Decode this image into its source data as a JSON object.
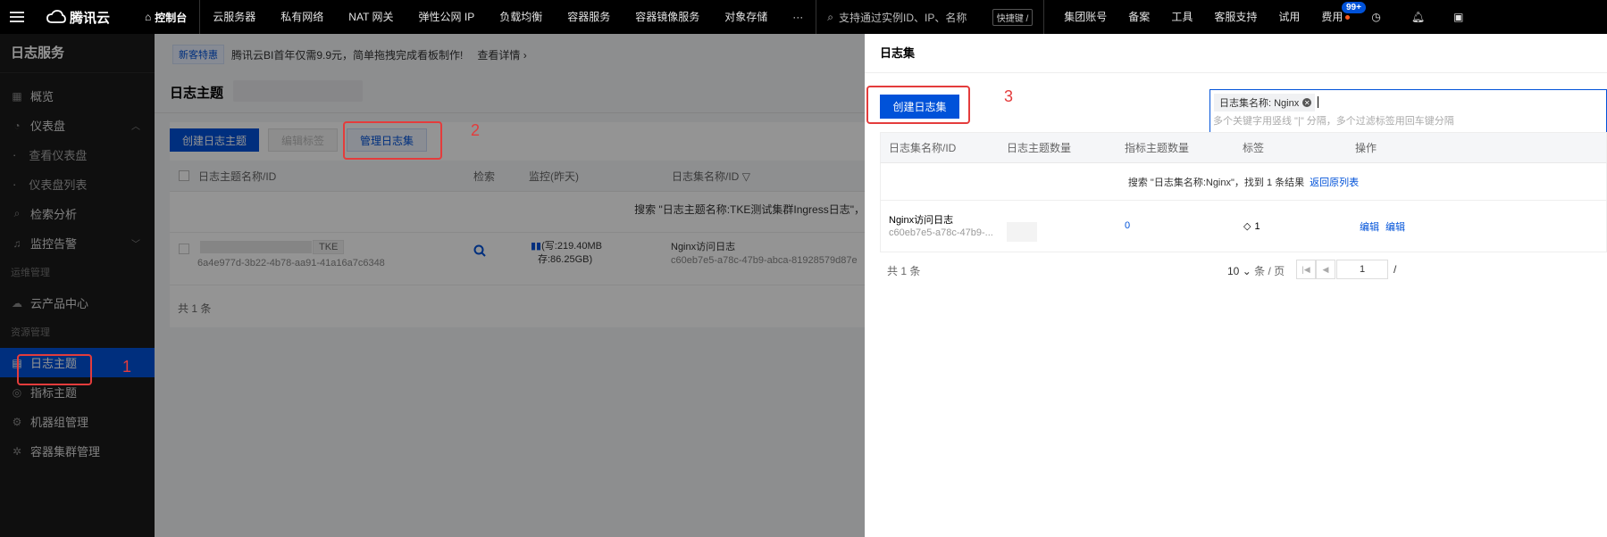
{
  "topnav": {
    "brand": "腾讯云",
    "console": "控制台",
    "items": [
      "云服务器",
      "私有网络",
      "NAT 网关",
      "弹性公网 IP",
      "负载均衡",
      "容器服务",
      "容器镜像服务",
      "对象存储",
      "···"
    ],
    "search_placeholder": "支持通过实例ID、IP、名称",
    "shortcut": "快捷键 /",
    "right_items": [
      "集团账号",
      "备案",
      "工具",
      "客服支持",
      "试用",
      "费用"
    ],
    "badge": "99+"
  },
  "sidebar": {
    "title": "日志服务",
    "items": {
      "overview": "概览",
      "dashboard": "仪表盘",
      "dashboard_view": "查看仪表盘",
      "dashboard_list": "仪表盘列表",
      "search": "检索分析",
      "alarm": "监控告警",
      "ops_group": "运维管理",
      "cloud_center": "云产品中心",
      "resource_group": "资源管理",
      "log_topic": "日志主题",
      "metric_topic": "指标主题",
      "machine_group": "机器组管理",
      "container_cluster": "容器集群管理"
    }
  },
  "main": {
    "promo_tag": "新客特惠",
    "promo_text": "腾讯云BI首年仅需9.9元，简单拖拽完成看板制作!",
    "promo_link": "查看详情",
    "page_title": "日志主题",
    "toolbar": {
      "create": "创建日志主题",
      "edit_tags": "编辑标签",
      "manage": "管理日志集"
    },
    "columns": [
      "日志主题名称/ID",
      "检索",
      "监控(昨天)",
      "日志集名称/ID"
    ],
    "search_hint": "搜索 \"日志主题名称:TKE测试集群Ingress日志\"，",
    "row": {
      "tag": "TKE",
      "id": "6a4e977d-3b22-4b78-aa91-41a16a7c6348",
      "monitor_write": "(写:219.40MB",
      "monitor_store": "存:86.25GB)",
      "logset_name": "Nginx访问日志",
      "logset_id": "c60eb7e5-a78c-47b9-abca-81928579d87e"
    },
    "total": "共 1 条"
  },
  "drawer": {
    "title": "日志集",
    "create": "创建日志集",
    "filter_chip": "日志集名称: Nginx",
    "filter_hint": "多个关键字用竖线 \"|\" 分隔，多个过滤标签用回车键分隔",
    "columns": [
      "日志集名称/ID",
      "日志主题数量",
      "指标主题数量",
      "标签",
      "操作"
    ],
    "result_text": "搜索 \"日志集名称:Nginx\"，找到 1 条结果",
    "result_link": "返回原列表",
    "row": {
      "name": "Nginx访问日志",
      "id": "c60eb7e5-a78c-47b9-...",
      "metric_count": "0",
      "tag_count": "1",
      "edit": "编辑",
      "edit2": "编辑"
    },
    "pager": {
      "total": "共 1 条",
      "size": "10",
      "size_unit": "条 / 页",
      "page": "1",
      "slash": "/"
    }
  },
  "annotations": [
    "1",
    "2",
    "3"
  ],
  "colors": {
    "accent": "#0052d9",
    "annotation": "#e43c3c"
  }
}
